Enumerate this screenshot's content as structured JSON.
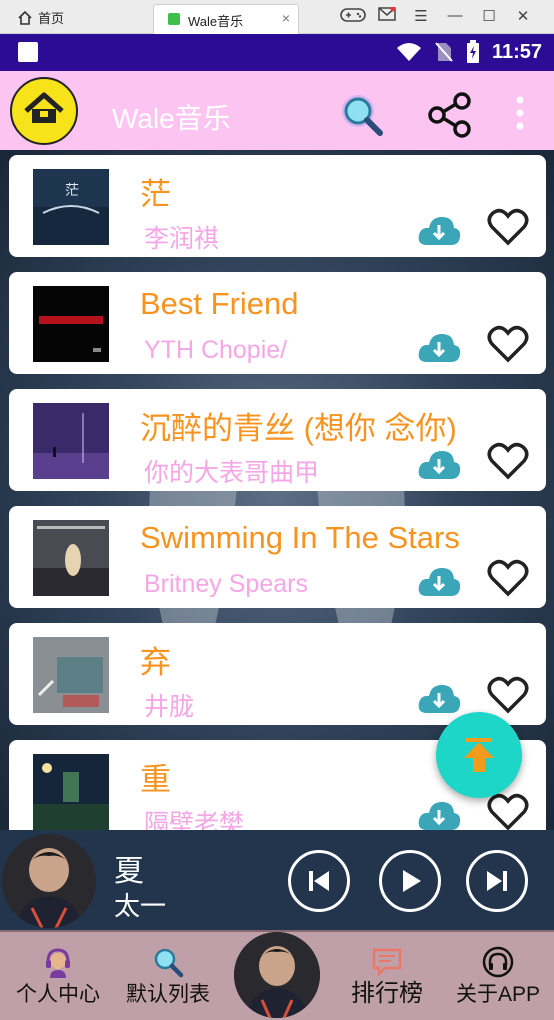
{
  "window": {
    "home_tab": "首页",
    "active_tab": "Wale音乐",
    "tab_close": "×"
  },
  "statusbar": {
    "time": "11:57"
  },
  "appbar": {
    "title": "Wale音乐"
  },
  "songs": [
    {
      "title": "茫",
      "artist": "李润祺"
    },
    {
      "title": "Best Friend",
      "artist": "YTH Chopie/"
    },
    {
      "title": "沉醉的青丝 (想你 念你)",
      "artist": "你的大表哥曲甲"
    },
    {
      "title": "Swimming In The Stars",
      "artist": "Britney Spears"
    },
    {
      "title": "弃",
      "artist": "井胧"
    },
    {
      "title": "重",
      "artist": "隔壁老樊"
    }
  ],
  "player": {
    "title": "夏",
    "artist": "太一"
  },
  "nav": [
    {
      "label": "个人中心"
    },
    {
      "label": "默认列表"
    },
    {
      "label": "排行榜"
    },
    {
      "label": "关于APP"
    }
  ],
  "colors": {
    "statusbar": "#2d0c95",
    "appbar": "#fbc4f1",
    "title": "#f7931e",
    "artist": "#f5a6e6",
    "fab": "#1ed6c8",
    "nav": "#c0a0a8"
  }
}
